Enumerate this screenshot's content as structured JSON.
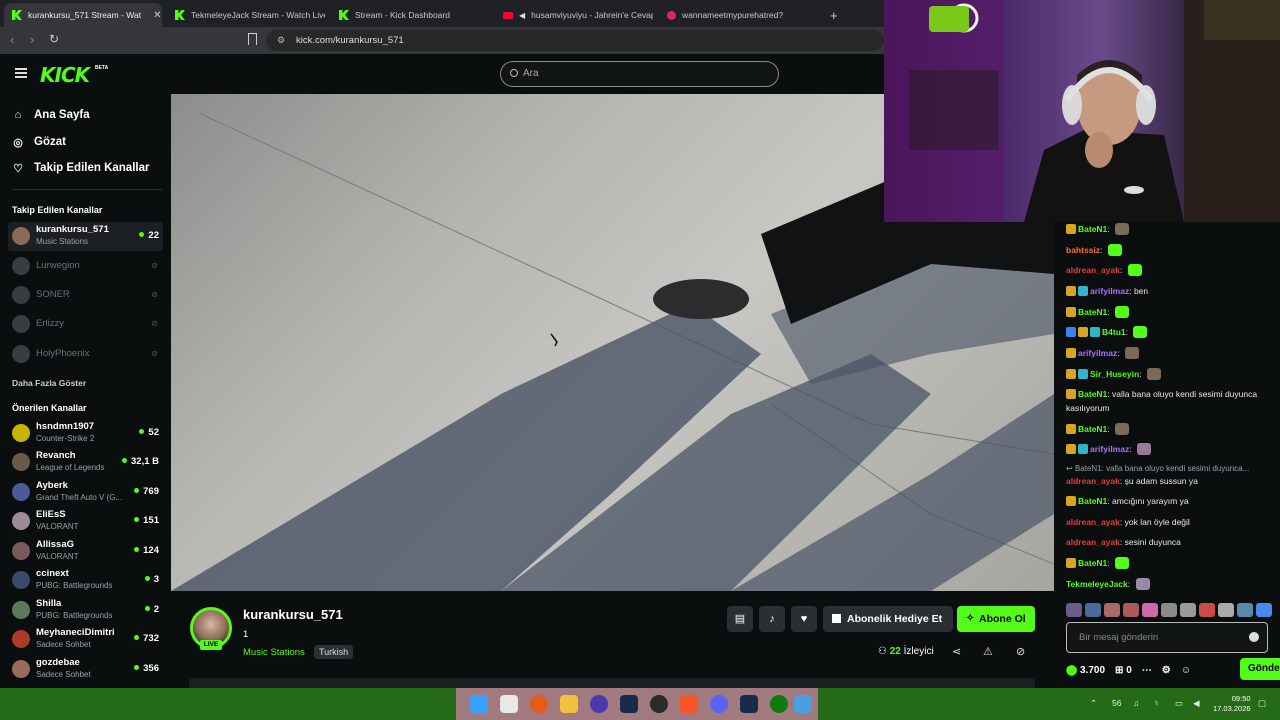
{
  "browser": {
    "tabs": [
      {
        "label": "kurankursu_571 Stream - Wat",
        "favicon": "kick-icon",
        "active": true
      },
      {
        "label": "TekmeleyeJack Stream - Watch Live o",
        "favicon": "kick-icon",
        "active": false
      },
      {
        "label": "Stream - Kick Dashboard",
        "favicon": "kick-icon",
        "active": false
      },
      {
        "label": "husamviyuviyu - Jahrein'e Cevap",
        "favicon": "youtube-icon",
        "active": false
      },
      {
        "label": "wannameetmypurehatred?",
        "favicon": "red-circle-icon",
        "active": false
      }
    ],
    "new_tab": "+",
    "close": "✕",
    "url": "kick.com/kurankursu_571"
  },
  "kick": {
    "logo": "KICK",
    "beta": "BETA",
    "search_placeholder": "Ara"
  },
  "sidebar": {
    "nav": [
      {
        "label": "Ana Sayfa",
        "icon": "home-icon"
      },
      {
        "label": "Gözat",
        "icon": "compass-icon"
      },
      {
        "label": "Takip Edilen Kanallar",
        "icon": "heart-icon"
      }
    ],
    "followed_title": "Takip Edilen Kanallar",
    "followed": [
      {
        "name": "kurankursu_571",
        "category": "Music Stations",
        "viewers": "22",
        "live": true
      },
      {
        "name": "Lurwegion",
        "live": false
      },
      {
        "name": "SONER",
        "live": false
      },
      {
        "name": "Erlizzy",
        "live": false
      },
      {
        "name": "HolyPhoenix",
        "live": false
      }
    ],
    "show_more": "Daha Fazla Göster",
    "recommended_title": "Önerilen Kanallar",
    "recommended": [
      {
        "name": "hsndmn1907",
        "category": "Counter-Strike 2",
        "viewers": "52"
      },
      {
        "name": "Revanch",
        "category": "League of Legends",
        "viewers": "32,1 B"
      },
      {
        "name": "Ayberk",
        "category": "Grand Theft Auto V (G...",
        "viewers": "769"
      },
      {
        "name": "EliEsS",
        "category": "VALORANT",
        "viewers": "151"
      },
      {
        "name": "AllissaG",
        "category": "VALORANT",
        "viewers": "124"
      },
      {
        "name": "ccinext",
        "category": "PUBG: Battlegrounds",
        "viewers": "3"
      },
      {
        "name": "Shilla",
        "category": "PUBG: Battlegrounds",
        "viewers": "2"
      },
      {
        "name": "MeyhaneciDimitri",
        "category": "Sadece Sohbet",
        "viewers": "732"
      },
      {
        "name": "gozdebae",
        "category": "Sadece Sohbet",
        "viewers": "356"
      }
    ]
  },
  "stream": {
    "channel": "kurankursu_571",
    "title": "1",
    "category": "Music Stations",
    "language": "Turkish",
    "live_label": "LIVE",
    "gift_label": "Abonelik Hediye Et",
    "subscribe_label": "Abone Ol",
    "viewers_count": "22",
    "viewers_label": "İzleyici"
  },
  "chat": {
    "messages": [
      {
        "user": "BateN1",
        "color": "#53fc18",
        "text": "",
        "emote": true
      },
      {
        "user": "bahtssiz",
        "color": "#ff6b3d",
        "text": "",
        "emote": true
      },
      {
        "user": "aldrean_ayak",
        "color": "#e33b3b",
        "text": "",
        "emote": true
      },
      {
        "user": "arifyilmaz",
        "color": "#b46bff",
        "text": "ben"
      },
      {
        "user": "BateN1",
        "color": "#53fc18",
        "text": "",
        "emote": true
      },
      {
        "user": "B4tu1",
        "color": "#53fc18",
        "text": "",
        "emote": true
      },
      {
        "user": "arifyilmaz",
        "color": "#b46bff",
        "text": "",
        "emote": true
      },
      {
        "user": "Sir_Huseyin",
        "color": "#53fc18",
        "text": "",
        "emote": true
      },
      {
        "user": "BateN1",
        "color": "#53fc18",
        "text": "valla bana oluyo kendi sesimi duyunca kasılıyorum"
      },
      {
        "user": "BateN1",
        "color": "#53fc18",
        "text": "",
        "emote": true
      },
      {
        "user": "arifyilmaz",
        "color": "#b46bff",
        "text": "",
        "emote": true
      },
      {
        "reply": "BateN1: valla bana oluyo kendi sesimi duyunca..."
      },
      {
        "user": "aldrean_ayak",
        "color": "#e33b3b",
        "text": "şu adam sussun ya"
      },
      {
        "user": "BateN1",
        "color": "#53fc18",
        "text": "amcığını yarayım ya"
      },
      {
        "user": "aldrean_ayak",
        "color": "#e33b3b",
        "text": "yok lan öyle değil"
      },
      {
        "user": "aldrean_ayak",
        "color": "#e33b3b",
        "text": "sesini duyunca"
      },
      {
        "user": "BateN1",
        "color": "#53fc18",
        "text": "",
        "emote": true
      },
      {
        "user": "TekmeleyeJack",
        "color": "#53fc18",
        "text": "",
        "emote": true
      }
    ],
    "input_placeholder": "Bir mesaj gönderin",
    "points": "3.700",
    "gift_count": "0",
    "send_label": "Gönder"
  },
  "taskbar": {
    "tray_number": "56",
    "time": "09:50",
    "date": "17.03.2026"
  }
}
